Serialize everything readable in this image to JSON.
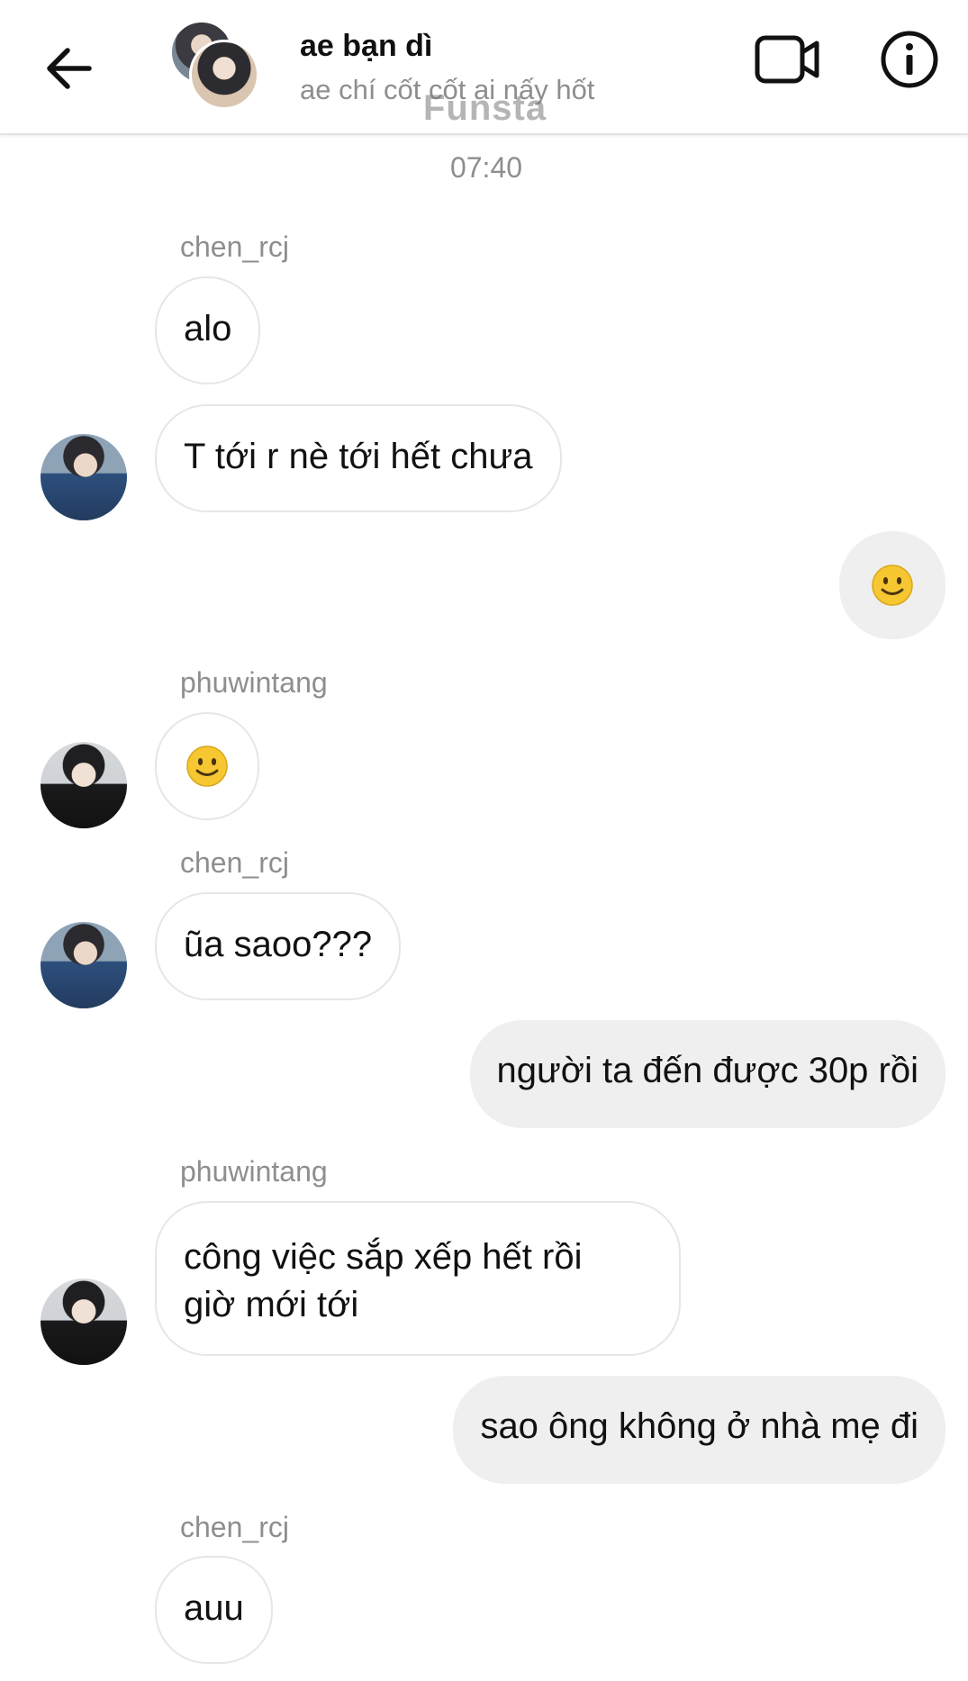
{
  "header": {
    "title": "ae bạn dì",
    "subtitle": "ae chí cốt cốt ai nấy hốt",
    "watermark": "Funsta",
    "icons": {
      "back": "arrow-left-icon",
      "video": "video-call-icon",
      "info": "info-icon"
    }
  },
  "conversation": {
    "timestamp": "07:40",
    "messages": [
      {
        "sender": "chen_rcj",
        "direction": "incoming",
        "text": "alo"
      },
      {
        "sender": "chen_rcj",
        "direction": "incoming",
        "text": "T tới r nè tới hết chưa"
      },
      {
        "sender": "me",
        "direction": "outgoing",
        "text": "🙂"
      },
      {
        "sender": "phuwintang",
        "direction": "incoming",
        "text": "🙂"
      },
      {
        "sender": "chen_rcj",
        "direction": "incoming",
        "text": "ũa saoo???"
      },
      {
        "sender": "me",
        "direction": "outgoing",
        "text": "người ta đến được 30p rồi"
      },
      {
        "sender": "phuwintang",
        "direction": "incoming",
        "lines": [
          "công việc sắp xếp hết rồi",
          "giờ mới tới"
        ]
      },
      {
        "sender": "me",
        "direction": "outgoing",
        "text": "sao ông không ở nhà mẹ đi"
      },
      {
        "sender": "chen_rcj",
        "direction": "incoming",
        "text": "auu"
      }
    ]
  },
  "colors": {
    "incoming_bubble_border": "#e6e6e6",
    "outgoing_bubble_bg": "#efefef",
    "muted_text": "#8e8e8e",
    "emoji_yellow": "#f7c731"
  }
}
